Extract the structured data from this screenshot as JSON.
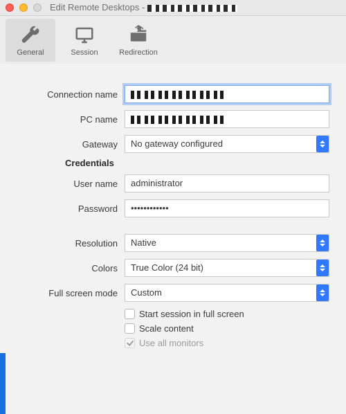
{
  "window": {
    "title_prefix": "Edit Remote Desktops - ",
    "title_suffix_redacted": true
  },
  "toolbar": {
    "items": [
      {
        "label": "General",
        "selected": true
      },
      {
        "label": "Session",
        "selected": false
      },
      {
        "label": "Redirection",
        "selected": false
      }
    ]
  },
  "form": {
    "connection_name": {
      "label": "Connection name",
      "value_redacted": true,
      "focused": true
    },
    "pc_name": {
      "label": "PC name",
      "value_redacted": true,
      "focused": false
    },
    "gateway": {
      "label": "Gateway",
      "value": "No gateway configured"
    },
    "credentials_heading": "Credentials",
    "user_name": {
      "label": "User name",
      "value": "administrator"
    },
    "password": {
      "label": "Password",
      "value": "••••••••••••"
    },
    "resolution": {
      "label": "Resolution",
      "value": "Native"
    },
    "colors": {
      "label": "Colors",
      "value": "True Color (24 bit)"
    },
    "full_screen": {
      "label": "Full screen mode",
      "value": "Custom"
    },
    "checkboxes": {
      "start_full_screen": {
        "label": "Start session in full screen",
        "checked": false,
        "enabled": true
      },
      "scale_content": {
        "label": "Scale content",
        "checked": false,
        "enabled": true
      },
      "use_all_monitors": {
        "label": "Use all monitors",
        "checked": true,
        "enabled": false
      }
    }
  }
}
